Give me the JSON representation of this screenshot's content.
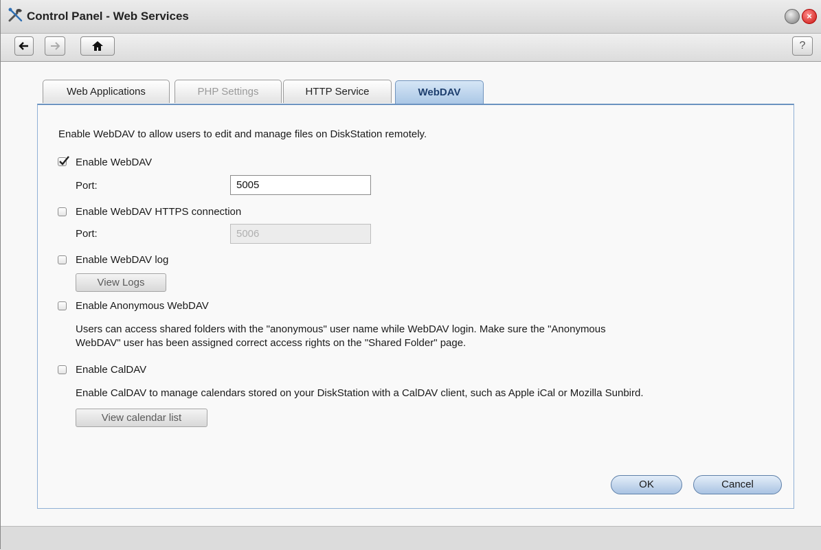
{
  "window": {
    "title": "Control Panel - Web Services"
  },
  "toolbar": {
    "help_label": "?"
  },
  "tabs": [
    {
      "label": "Web Applications",
      "state": "normal"
    },
    {
      "label": "PHP Settings",
      "state": "disabled"
    },
    {
      "label": "HTTP Service",
      "state": "normal"
    },
    {
      "label": "WebDAV",
      "state": "active"
    }
  ],
  "webdav": {
    "description": "Enable WebDAV to allow users to edit and manage files on DiskStation remotely.",
    "enable_webdav": {
      "label": "Enable WebDAV",
      "checked": true
    },
    "http_port": {
      "label": "Port:",
      "value": "5005"
    },
    "enable_https": {
      "label": "Enable WebDAV HTTPS connection",
      "checked": false
    },
    "https_port": {
      "label": "Port:",
      "value": "5006",
      "disabled": true
    },
    "enable_log": {
      "label": "Enable WebDAV log",
      "checked": false
    },
    "view_logs_label": "View Logs",
    "enable_anonymous": {
      "label": "Enable Anonymous WebDAV",
      "checked": false
    },
    "anonymous_note_line1": "Users can access shared folders with the \"anonymous\" user name while WebDAV login. Make sure the \"Anonymous",
    "anonymous_note_line2": "WebDAV\" user has been assigned correct access rights on the \"Shared Folder\" page.",
    "enable_caldav": {
      "label": "Enable CalDAV",
      "checked": false
    },
    "caldav_note": "Enable CalDAV to manage calendars stored on your DiskStation with a CalDAV client, such as Apple iCal or Mozilla Sunbird.",
    "view_calendar_label": "View calendar list"
  },
  "footer": {
    "ok_label": "OK",
    "cancel_label": "Cancel"
  },
  "colors": {
    "accent": "#6b92c0",
    "active_tab_text": "#1e3f6e",
    "close_button": "#c9140f"
  }
}
